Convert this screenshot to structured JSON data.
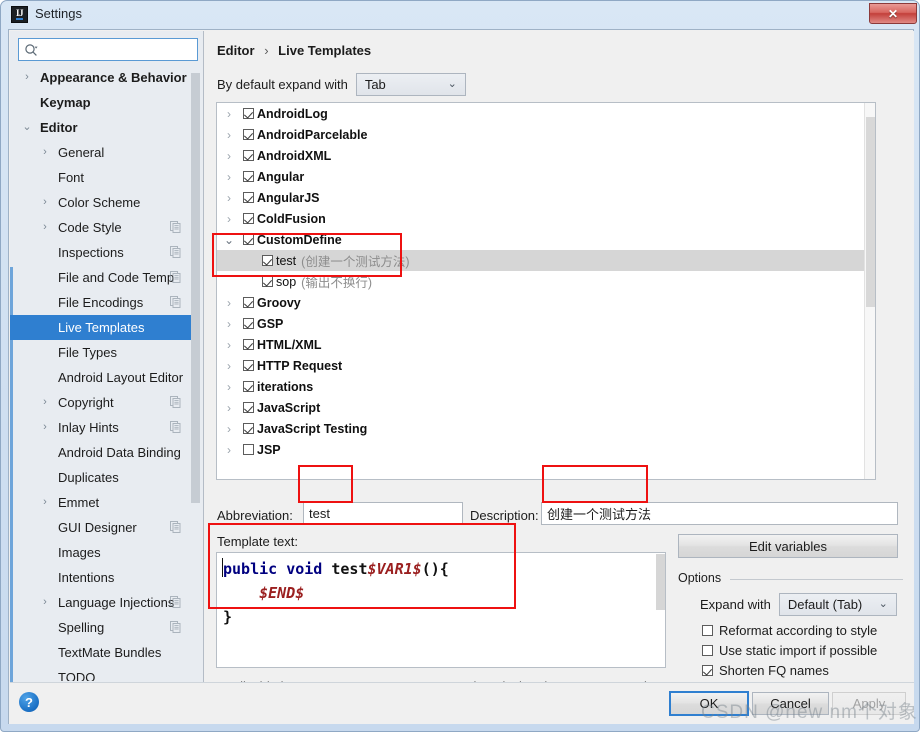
{
  "window": {
    "title": "Settings",
    "app_icon": "intellij-idea-icon",
    "close_label": "✕"
  },
  "search": {
    "placeholder": "",
    "value": "",
    "icon": "search-icon"
  },
  "sidebar": {
    "items": [
      {
        "label": "Appearance & Behavior",
        "level": 0,
        "arrow": "›",
        "selected": false,
        "badge": false
      },
      {
        "label": "Keymap",
        "level": 0,
        "arrow": "",
        "selected": false,
        "badge": false
      },
      {
        "label": "Editor",
        "level": 0,
        "arrow": "⌄",
        "selected": false,
        "badge": false
      },
      {
        "label": "General",
        "level": 1,
        "arrow": "›",
        "selected": false,
        "badge": false
      },
      {
        "label": "Font",
        "level": 1,
        "arrow": "",
        "selected": false,
        "badge": false
      },
      {
        "label": "Color Scheme",
        "level": 1,
        "arrow": "›",
        "selected": false,
        "badge": false
      },
      {
        "label": "Code Style",
        "level": 1,
        "arrow": "›",
        "selected": false,
        "badge": true
      },
      {
        "label": "Inspections",
        "level": 1,
        "arrow": "",
        "selected": false,
        "badge": true
      },
      {
        "label": "File and Code Temp",
        "level": 1,
        "arrow": "",
        "selected": false,
        "badge": true
      },
      {
        "label": "File Encodings",
        "level": 1,
        "arrow": "",
        "selected": false,
        "badge": true
      },
      {
        "label": "Live Templates",
        "level": 1,
        "arrow": "",
        "selected": true,
        "badge": false
      },
      {
        "label": "File Types",
        "level": 1,
        "arrow": "",
        "selected": false,
        "badge": false
      },
      {
        "label": "Android Layout Editor",
        "level": 1,
        "arrow": "",
        "selected": false,
        "badge": false
      },
      {
        "label": "Copyright",
        "level": 1,
        "arrow": "›",
        "selected": false,
        "badge": true
      },
      {
        "label": "Inlay Hints",
        "level": 1,
        "arrow": "›",
        "selected": false,
        "badge": true
      },
      {
        "label": "Android Data Binding",
        "level": 1,
        "arrow": "",
        "selected": false,
        "badge": false
      },
      {
        "label": "Duplicates",
        "level": 1,
        "arrow": "",
        "selected": false,
        "badge": false
      },
      {
        "label": "Emmet",
        "level": 1,
        "arrow": "›",
        "selected": false,
        "badge": false
      },
      {
        "label": "GUI Designer",
        "level": 1,
        "arrow": "",
        "selected": false,
        "badge": true
      },
      {
        "label": "Images",
        "level": 1,
        "arrow": "",
        "selected": false,
        "badge": false
      },
      {
        "label": "Intentions",
        "level": 1,
        "arrow": "",
        "selected": false,
        "badge": false
      },
      {
        "label": "Language Injections",
        "level": 1,
        "arrow": "›",
        "selected": false,
        "badge": true
      },
      {
        "label": "Spelling",
        "level": 1,
        "arrow": "",
        "selected": false,
        "badge": true
      },
      {
        "label": "TextMate Bundles",
        "level": 1,
        "arrow": "",
        "selected": false,
        "badge": false
      },
      {
        "label": "TODO",
        "level": 1,
        "arrow": "",
        "selected": false,
        "badge": false
      }
    ]
  },
  "breadcrumb": {
    "root": "Editor",
    "separator": "›",
    "current": "Live Templates"
  },
  "expand_row": {
    "label": "By default expand with",
    "value": "Tab",
    "chevron": "⌄"
  },
  "tree": {
    "rows": [
      {
        "label": "AndroidLog",
        "desc": "",
        "level": 0,
        "arrow": "›",
        "checked": true,
        "selected": false
      },
      {
        "label": "AndroidParcelable",
        "desc": "",
        "level": 0,
        "arrow": "›",
        "checked": true,
        "selected": false
      },
      {
        "label": "AndroidXML",
        "desc": "",
        "level": 0,
        "arrow": "›",
        "checked": true,
        "selected": false
      },
      {
        "label": "Angular",
        "desc": "",
        "level": 0,
        "arrow": "›",
        "checked": true,
        "selected": false
      },
      {
        "label": "AngularJS",
        "desc": "",
        "level": 0,
        "arrow": "›",
        "checked": true,
        "selected": false
      },
      {
        "label": "ColdFusion",
        "desc": "",
        "level": 0,
        "arrow": "›",
        "checked": true,
        "selected": false
      },
      {
        "label": "CustomDefine",
        "desc": "",
        "level": 0,
        "arrow": "⌄",
        "checked": true,
        "selected": false
      },
      {
        "label": "test",
        "desc": "(创建一个测试方法)",
        "level": 1,
        "arrow": "",
        "checked": true,
        "selected": true
      },
      {
        "label": "sop",
        "desc": "(输出不换行)",
        "level": 1,
        "arrow": "",
        "checked": true,
        "selected": false
      },
      {
        "label": "Groovy",
        "desc": "",
        "level": 0,
        "arrow": "›",
        "checked": true,
        "selected": false
      },
      {
        "label": "GSP",
        "desc": "",
        "level": 0,
        "arrow": "›",
        "checked": true,
        "selected": false
      },
      {
        "label": "HTML/XML",
        "desc": "",
        "level": 0,
        "arrow": "›",
        "checked": true,
        "selected": false
      },
      {
        "label": "HTTP Request",
        "desc": "",
        "level": 0,
        "arrow": "›",
        "checked": true,
        "selected": false
      },
      {
        "label": "iterations",
        "desc": "",
        "level": 0,
        "arrow": "›",
        "checked": true,
        "selected": false
      },
      {
        "label": "JavaScript",
        "desc": "",
        "level": 0,
        "arrow": "›",
        "checked": true,
        "selected": false
      },
      {
        "label": "JavaScript Testing",
        "desc": "",
        "level": 0,
        "arrow": "›",
        "checked": true,
        "selected": false
      },
      {
        "label": "JSP",
        "desc": "",
        "level": 0,
        "arrow": "›",
        "checked": false,
        "selected": false
      }
    ]
  },
  "tree_tools": [
    {
      "name": "add-template-button",
      "glyph": "plus"
    },
    {
      "name": "remove-template-button",
      "glyph": "minus"
    },
    {
      "name": "copy-template-button",
      "glyph": "copy"
    },
    {
      "name": "revert-template-button",
      "glyph": "undo"
    }
  ],
  "abbreviation": {
    "label": "Abbreviation:",
    "value": "test",
    "placeholder": ""
  },
  "description": {
    "label": "Description:",
    "value": "创建一个测试方法",
    "placeholder": ""
  },
  "template_text": {
    "label": "Template text:",
    "lines": [
      [
        {
          "t": "public void ",
          "c": "kw"
        },
        {
          "t": "test",
          "c": "id"
        },
        {
          "t": "$VAR1$",
          "c": "var"
        },
        {
          "t": "(){",
          "c": "id"
        }
      ],
      [
        {
          "t": "    ",
          "c": "id"
        },
        {
          "t": "$END$",
          "c": "var"
        }
      ],
      [
        {
          "t": "}",
          "c": "id"
        }
      ]
    ]
  },
  "applicable": "Applicable in Java; Java: statement, expression, declaration, comment, string,",
  "edit_variables": {
    "label": "Edit variables"
  },
  "options": {
    "legend": "Options",
    "expand_with_label": "Expand with",
    "expand_with_value": "Default (Tab)",
    "chevron": "⌄",
    "checkboxes": [
      {
        "label": "Reformat according to style",
        "checked": false
      },
      {
        "label": "Use static import if possible",
        "checked": false
      },
      {
        "label": "Shorten FQ names",
        "checked": true
      }
    ]
  },
  "footer": {
    "help_label": "?",
    "ok_label": "OK",
    "cancel_label": "Cancel",
    "apply_label": "Apply"
  },
  "watermark": "CSDN @new nm个对象",
  "colors": {
    "accent_blue": "#2f7fd0",
    "annotation_red": "#ee1111",
    "selection_gray": "#d6d6d6",
    "keyword_blue": "#000080",
    "variable_red": "#9b2020"
  }
}
